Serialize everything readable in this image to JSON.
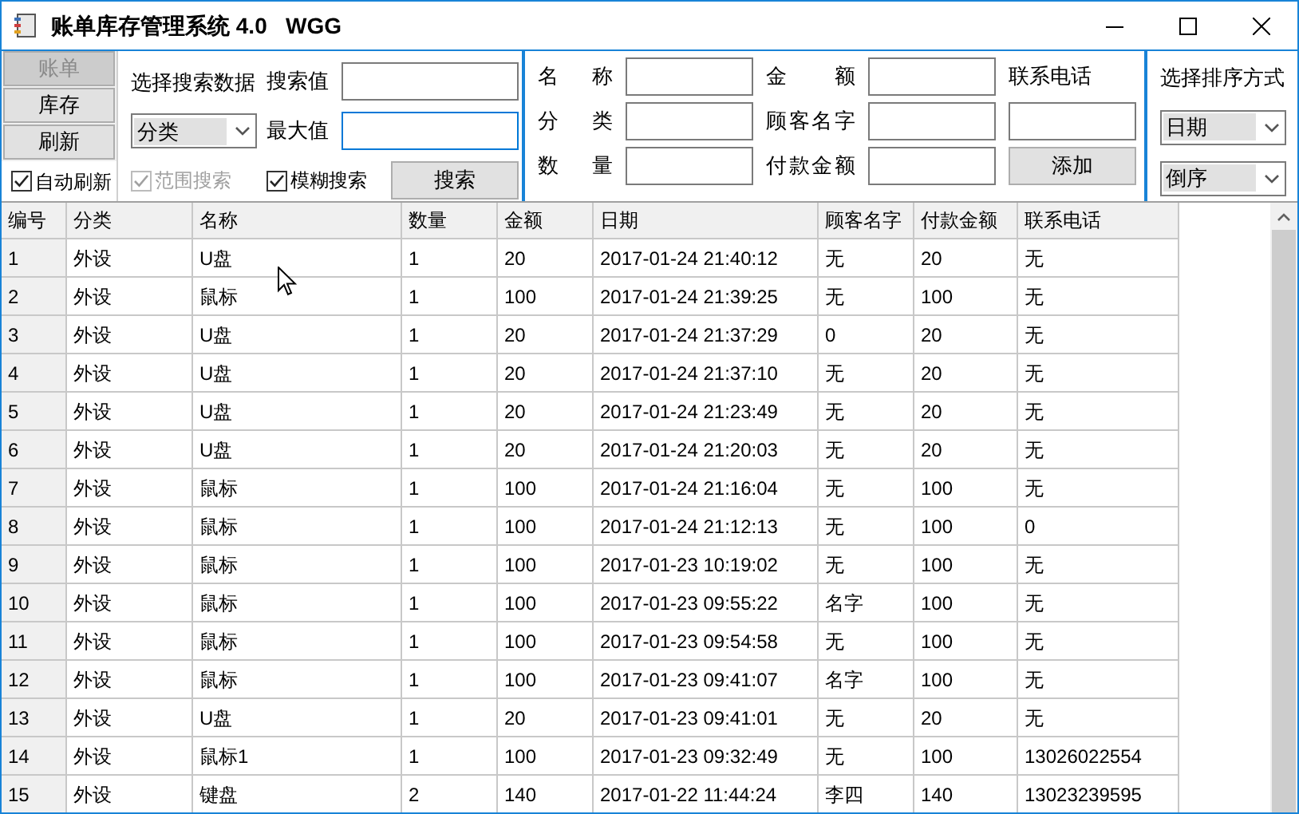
{
  "window": {
    "title": "账单库存管理系统 4.0   WGG"
  },
  "nav_buttons": [
    {
      "label": "账单",
      "disabled": true
    },
    {
      "label": "库存",
      "disabled": false
    },
    {
      "label": "刷新",
      "disabled": false
    }
  ],
  "auto_refresh": {
    "label": "自动刷新",
    "checked": true
  },
  "search": {
    "title": "选择搜索数据",
    "field_select": "分类",
    "value_label": "搜索值",
    "max_label": "最大值",
    "max_focused": true,
    "options": [
      {
        "label": "范围搜索",
        "checked": true,
        "disabled": true
      },
      {
        "label": "模糊搜索",
        "checked": true,
        "disabled": false
      }
    ],
    "button": "搜索"
  },
  "add_form": {
    "left": [
      {
        "label": "名 称"
      },
      {
        "label": "分 类"
      },
      {
        "label": "数 量"
      }
    ],
    "middle": [
      {
        "label": "金 额"
      },
      {
        "label": "顾客名字"
      },
      {
        "label": "付款金额"
      }
    ],
    "phone_label": "联系电话",
    "button": "添加"
  },
  "sort": {
    "title": "选择排序方式",
    "field": "日期",
    "order": "倒序"
  },
  "table": {
    "columns": [
      "编号",
      "分类",
      "名称",
      "数量",
      "金额",
      "日期",
      "顾客名字",
      "付款金额",
      "联系电话"
    ],
    "rows": [
      [
        "1",
        "外设",
        "U盘",
        "1",
        "20",
        "2017-01-24 21:40:12",
        "无",
        "20",
        "无"
      ],
      [
        "2",
        "外设",
        "鼠标",
        "1",
        "100",
        "2017-01-24 21:39:25",
        "无",
        "100",
        "无"
      ],
      [
        "3",
        "外设",
        "U盘",
        "1",
        "20",
        "2017-01-24 21:37:29",
        "0",
        "20",
        "无"
      ],
      [
        "4",
        "外设",
        "U盘",
        "1",
        "20",
        "2017-01-24 21:37:10",
        "无",
        "20",
        "无"
      ],
      [
        "5",
        "外设",
        "U盘",
        "1",
        "20",
        "2017-01-24 21:23:49",
        "无",
        "20",
        "无"
      ],
      [
        "6",
        "外设",
        "U盘",
        "1",
        "20",
        "2017-01-24 21:20:03",
        "无",
        "20",
        "无"
      ],
      [
        "7",
        "外设",
        "鼠标",
        "1",
        "100",
        "2017-01-24 21:16:04",
        "无",
        "100",
        "无"
      ],
      [
        "8",
        "外设",
        "鼠标",
        "1",
        "100",
        "2017-01-24 21:12:13",
        "无",
        "100",
        "0"
      ],
      [
        "9",
        "外设",
        "鼠标",
        "1",
        "100",
        "2017-01-23 10:19:02",
        "无",
        "100",
        "无"
      ],
      [
        "10",
        "外设",
        "鼠标",
        "1",
        "100",
        "2017-01-23 09:55:22",
        "名字",
        "100",
        "无"
      ],
      [
        "11",
        "外设",
        "鼠标",
        "1",
        "100",
        "2017-01-23 09:54:58",
        "无",
        "100",
        "无"
      ],
      [
        "12",
        "外设",
        "鼠标",
        "1",
        "100",
        "2017-01-23 09:41:07",
        "名字",
        "100",
        "无"
      ],
      [
        "13",
        "外设",
        "U盘",
        "1",
        "20",
        "2017-01-23 09:41:01",
        "无",
        "20",
        "无"
      ],
      [
        "14",
        "外设",
        "鼠标1",
        "1",
        "100",
        "2017-01-23 09:32:49",
        "无",
        "100",
        "13026022554"
      ],
      [
        "15",
        "外设",
        "键盘",
        "2",
        "140",
        "2017-01-22 11:44:24",
        "李四",
        "140",
        "13023239595"
      ]
    ]
  }
}
